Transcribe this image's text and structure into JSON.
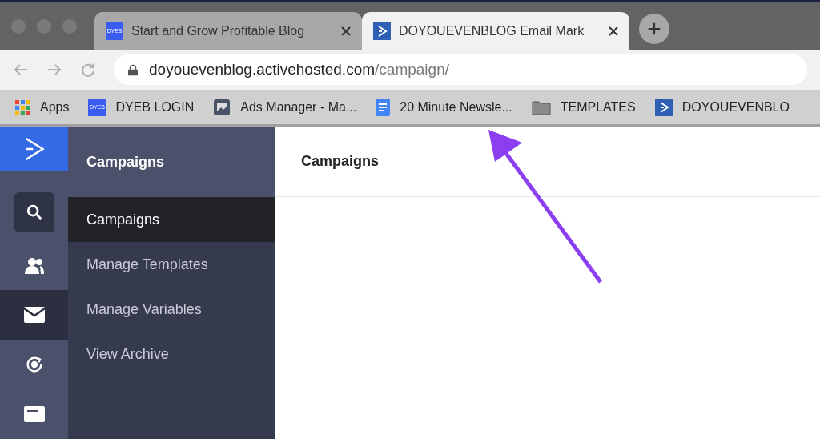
{
  "browser": {
    "tabs": [
      {
        "label": "Start and Grow Profitable Blog",
        "kind": "dyeb",
        "badge": "DYEB",
        "selected": false
      },
      {
        "label": "DOYOUEVENBLOG Email Mark",
        "kind": "ac",
        "selected": true
      }
    ],
    "url": {
      "host": "doyouevenblog.activehosted.com",
      "path": "/campaign/"
    },
    "bookmarks": [
      {
        "label": "Apps",
        "kind": "apps"
      },
      {
        "label": "DYEB LOGIN",
        "kind": "dyeb",
        "badge": "DYEB"
      },
      {
        "label": "Ads Manager - Ma...",
        "kind": "ads"
      },
      {
        "label": "20 Minute Newsle...",
        "kind": "doc"
      },
      {
        "label": "TEMPLATES",
        "kind": "folder"
      },
      {
        "label": "DOYOUEVENBLO",
        "kind": "ac"
      }
    ]
  },
  "rail": [
    {
      "kind": "search",
      "selected": false
    },
    {
      "kind": "contacts",
      "selected": false
    },
    {
      "kind": "mail",
      "selected": true
    },
    {
      "kind": "automation",
      "selected": false
    },
    {
      "kind": "forms",
      "selected": false
    }
  ],
  "nav": {
    "title": "Campaigns",
    "items": [
      {
        "label": "Campaigns",
        "selected": true
      },
      {
        "label": "Manage Templates",
        "selected": false
      },
      {
        "label": "Manage Variables",
        "selected": false
      },
      {
        "label": "View Archive",
        "selected": false
      }
    ]
  },
  "main": {
    "title": "Campaigns"
  }
}
